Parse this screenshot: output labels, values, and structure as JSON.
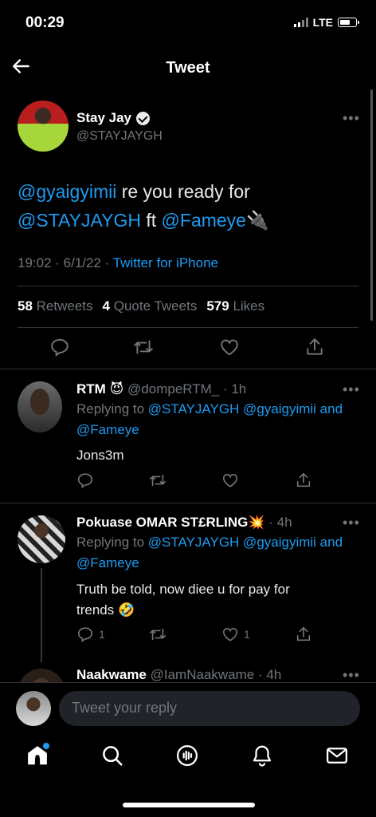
{
  "status_bar": {
    "time": "00:29",
    "network": "LTE"
  },
  "header": {
    "title": "Tweet"
  },
  "tweet": {
    "author_name": "Stay Jay",
    "author_handle": "@STAYJAYGH",
    "text_parts": [
      "@gyaigyimii",
      " re you ready for ",
      "@STAYJAYGH",
      " ft ",
      "@Fameye",
      " 🔌"
    ],
    "time": "19:02 · 6/1/22 · ",
    "source": "Twitter for iPhone",
    "retweets": "58",
    "retweets_label": "Retweets",
    "quotes": "4",
    "quotes_label": "Quote Tweets",
    "likes": "579",
    "likes_label": "Likes"
  },
  "replies": [
    {
      "name": "RTM",
      "name_emoji": "😈",
      "handle": "@dompeRTM_ · 1h",
      "replying_prefix": "Replying to ",
      "replying_to": "@STAYJAYGH @gyaigyimii and",
      "replying_to_2": "@Fameye",
      "text": "Jons3m",
      "reply_count": "",
      "like_count": ""
    },
    {
      "name": "Pokuase OMAR ST£RLING",
      "name_emoji": "💥",
      "handle": " · 4h",
      "replying_prefix": "Replying to ",
      "replying_to": "@STAYJAYGH @gyaigyimii and",
      "replying_to_2": "@Fameye",
      "text": "Truth be told, now diee u for pay for",
      "text_2": "trends 🤣",
      "reply_count": "1",
      "like_count": "1"
    },
    {
      "name": "Naakwame",
      "handle": "@IamNaakwame · 4h"
    }
  ],
  "composer": {
    "placeholder": "Tweet your reply"
  },
  "nav": [
    "home-icon",
    "search-icon",
    "spaces-icon",
    "notifications-icon",
    "messages-icon"
  ],
  "colors": {
    "accent": "#1d9bf0",
    "background": "#000000",
    "muted": "#71767b"
  }
}
